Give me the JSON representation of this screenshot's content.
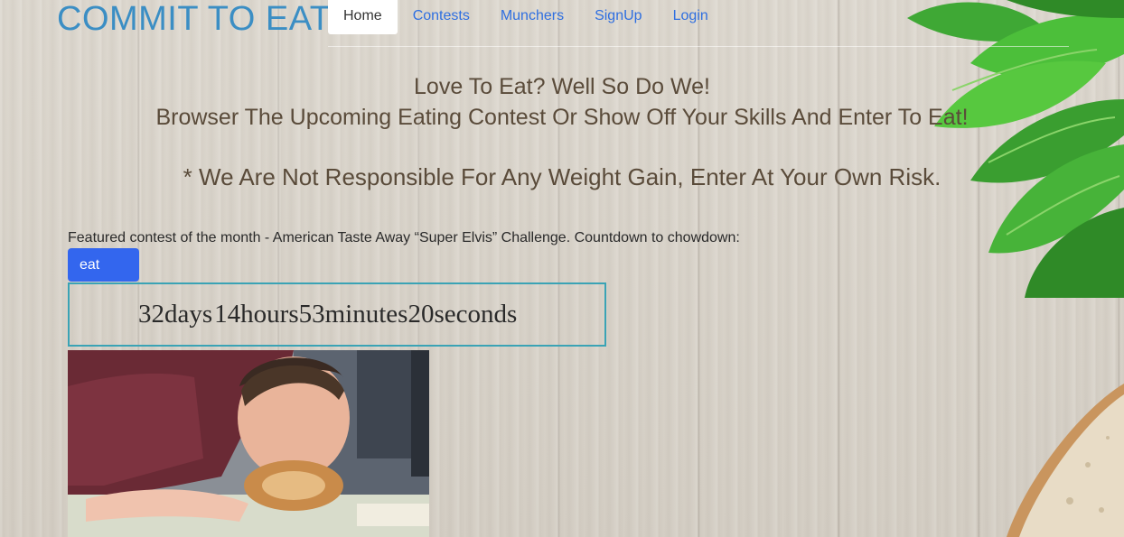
{
  "brand": "COMMIT TO EAT",
  "nav": {
    "home": "Home",
    "contests": "Contests",
    "munchers": "Munchers",
    "signup": "SignUp",
    "login": "Login"
  },
  "hero": {
    "line1": "Love To Eat? Well So Do We!",
    "line2": "Browser The Upcoming Eating Contest Or Show Off Your Skills And Enter To Eat!",
    "disclaimer": "* We Are Not Responsible For Any Weight Gain, Enter At Your Own Risk."
  },
  "featured": {
    "text": "Featured contest of the month - American Taste Away “Super Elvis” Challenge. Countdown to chowdown:",
    "button": "eat"
  },
  "countdown": {
    "days": "32",
    "days_label": "days",
    "hours": "14",
    "hours_label": "hours",
    "minutes": "53",
    "minutes_label": "minutes",
    "seconds": "20",
    "seconds_label": "seconds"
  },
  "colors": {
    "brand": "#3b8ec4",
    "link": "#2f6fe0",
    "button": "#3366ee",
    "countdown_border": "#3aa3b5",
    "hero_text": "#5a4b3a"
  }
}
